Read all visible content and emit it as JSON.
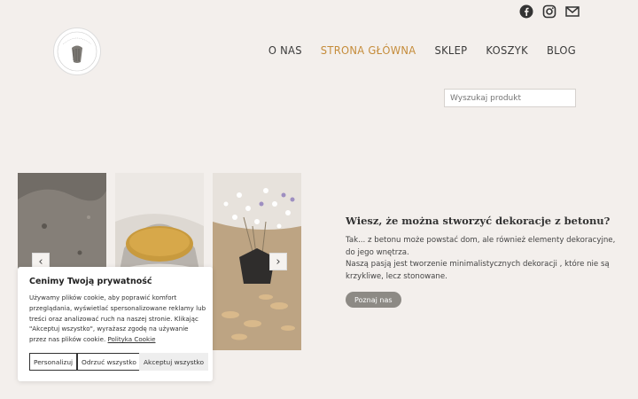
{
  "social": {
    "icons": [
      "facebook-icon",
      "instagram-icon",
      "mail-icon"
    ]
  },
  "logo": {
    "icon": "logo-circle"
  },
  "nav": {
    "items": [
      "O NAS",
      "STRONA GŁÓWNA",
      "SKLEP",
      "KOSZYK",
      "BLOG"
    ],
    "active_index": 1,
    "active_color": "#c58c3a"
  },
  "search": {
    "placeholder": "Wyszukaj produkt"
  },
  "carousel": {
    "prev_icon": "chevron-left-icon",
    "next_icon": "chevron-right-icon"
  },
  "hero": {
    "heading": "Wiesz, że można stworzyć dekoracje z betonu?",
    "line1": "Tak... z betonu może powstać dom, ale również elementy dekoracyjne, do jego wnętrza.",
    "line2": "Naszą pasją jest tworzenie minimalistycznych dekoracji , które nie są krzykliwe, lecz stonowane.",
    "button": "Poznaj nas"
  },
  "cookie": {
    "title": "Cenimy Twoją prywatność",
    "text": "Używamy plików cookie, aby poprawić komfort przeglądania, wyświetlać spersonalizowane reklamy lub treści oraz analizować ruch na naszej stronie. Klikając \"Akceptuj wszystko\", wyrażasz zgodę na używanie przez nas plików cookie.",
    "policy_link": "Polityka Cookie",
    "btn_customize": "Personalizuj",
    "btn_reject": "Odrzuć wszystko",
    "btn_accept": "Akceptuj wszystko"
  }
}
